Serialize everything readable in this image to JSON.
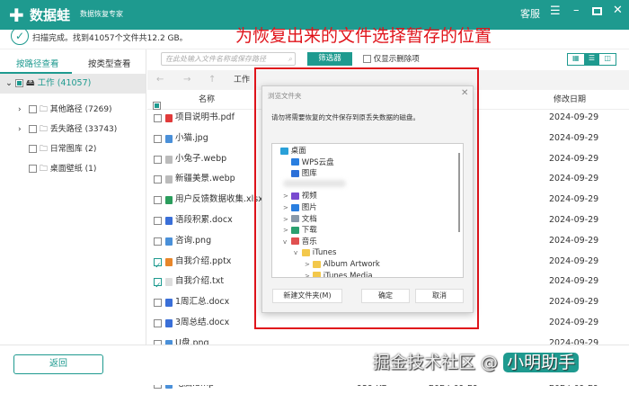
{
  "header": {
    "app_name": "数据蛙",
    "subtitle": "数据恢复专家",
    "support": "客服",
    "accent": "#1e9a8f"
  },
  "status": {
    "text": "扫描完成。找到41057个文件共12.2 GB。"
  },
  "annotation": "为恢复出来的文件选择暂存的位置",
  "left": {
    "tabs": [
      "按路径查看",
      "按类型查看"
    ],
    "root": "工作 (41057)",
    "items": [
      {
        "label": "其他路径 (7269)",
        "expand": true
      },
      {
        "label": "丢失路径 (33743)",
        "expand": true
      },
      {
        "label": "日常图库 (2)",
        "expand": false
      },
      {
        "label": "桌面壁纸 (1)",
        "expand": false
      }
    ]
  },
  "toolbar": {
    "search_placeholder": "在此处输入文件名称或保存路径",
    "filter": "筛选器",
    "only_deleted": "仅显示删除项",
    "path": "工作"
  },
  "columns": {
    "name": "名称",
    "modified": "修改日期"
  },
  "files": [
    {
      "name": "项目说明书.pdf",
      "icon": "pdf",
      "checked": false,
      "size": "",
      "created": "",
      "modified": "2024-09-29"
    },
    {
      "name": "小猫.jpg",
      "icon": "image",
      "checked": false,
      "size": "",
      "created": "",
      "modified": "2024-09-29"
    },
    {
      "name": "小兔子.webp",
      "icon": "webp",
      "checked": false,
      "size": "",
      "created": "",
      "modified": "2024-09-29"
    },
    {
      "name": "新疆美景.webp",
      "icon": "webp",
      "checked": false,
      "size": "",
      "created": "",
      "modified": "2024-09-29"
    },
    {
      "name": "用户反馈数据收集.xlsx",
      "icon": "xlsx",
      "checked": false,
      "size": "",
      "created": "",
      "modified": "2024-09-29"
    },
    {
      "name": "语段积累.docx",
      "icon": "docx",
      "checked": false,
      "size": "",
      "created": "",
      "modified": "2024-09-29"
    },
    {
      "name": "咨询.png",
      "icon": "image",
      "checked": false,
      "size": "",
      "created": "",
      "modified": "2024-09-29"
    },
    {
      "name": "自我介绍.pptx",
      "icon": "pptx",
      "checked": true,
      "size": "",
      "created": "",
      "modified": "2024-09-29"
    },
    {
      "name": "自我介绍.txt",
      "icon": "txt",
      "checked": true,
      "size": "",
      "created": "",
      "modified": "2024-09-29"
    },
    {
      "name": "1周汇总.docx",
      "icon": "docx",
      "checked": false,
      "size": "",
      "created": "",
      "modified": "2024-09-29"
    },
    {
      "name": "3周总结.docx",
      "icon": "docx",
      "checked": false,
      "size": "",
      "created": "",
      "modified": "2024-09-29"
    },
    {
      "name": "U盘.png",
      "icon": "image",
      "checked": false,
      "size": "",
      "created": "",
      "modified": "2024-09-29"
    },
    {
      "name": "部分文本模板原形.txt",
      "icon": "txt",
      "checked": false,
      "size": "387  B",
      "created": "2024-09-29",
      "modified": "2024-09-29"
    },
    {
      "name": "电脑.bmp",
      "icon": "image",
      "checked": false,
      "size": "959 KB",
      "created": "2024-09-29",
      "modified": "2024-09-29"
    }
  ],
  "dialog": {
    "title": "浏览文件夹",
    "message": "请勿将需要恢复的文件保存到原丢失数据的磁盘。",
    "tree": [
      {
        "label": "桌面",
        "level": 0,
        "arrow": "",
        "icon": "desktop"
      },
      {
        "label": "WPS云盘",
        "level": 1,
        "arrow": "",
        "icon": "cloud"
      },
      {
        "label": "图库",
        "level": 1,
        "arrow": "",
        "icon": "gallery"
      },
      {
        "label": "",
        "level": 1,
        "arrow": "",
        "icon": "blurred"
      },
      {
        "label": "视频",
        "level": 1,
        "arrow": ">",
        "icon": "video"
      },
      {
        "label": "图片",
        "level": 1,
        "arrow": ">",
        "icon": "pictures"
      },
      {
        "label": "文档",
        "level": 1,
        "arrow": ">",
        "icon": "documents"
      },
      {
        "label": "下载",
        "level": 1,
        "arrow": ">",
        "icon": "download"
      },
      {
        "label": "音乐",
        "level": 1,
        "arrow": "v",
        "icon": "music"
      },
      {
        "label": "iTunes",
        "level": 2,
        "arrow": "v",
        "icon": "folder"
      },
      {
        "label": "Album Artwork",
        "level": 3,
        "arrow": ">",
        "icon": "folder"
      },
      {
        "label": "iTunes Media",
        "level": 3,
        "arrow": ">",
        "icon": "folder"
      }
    ],
    "new_folder": "新建文件夹(M)",
    "ok": "确定",
    "cancel": "取消"
  },
  "bottom": {
    "back": "返回"
  },
  "watermark": {
    "left": "掘金技术社区 @",
    "right": "小明助手"
  }
}
